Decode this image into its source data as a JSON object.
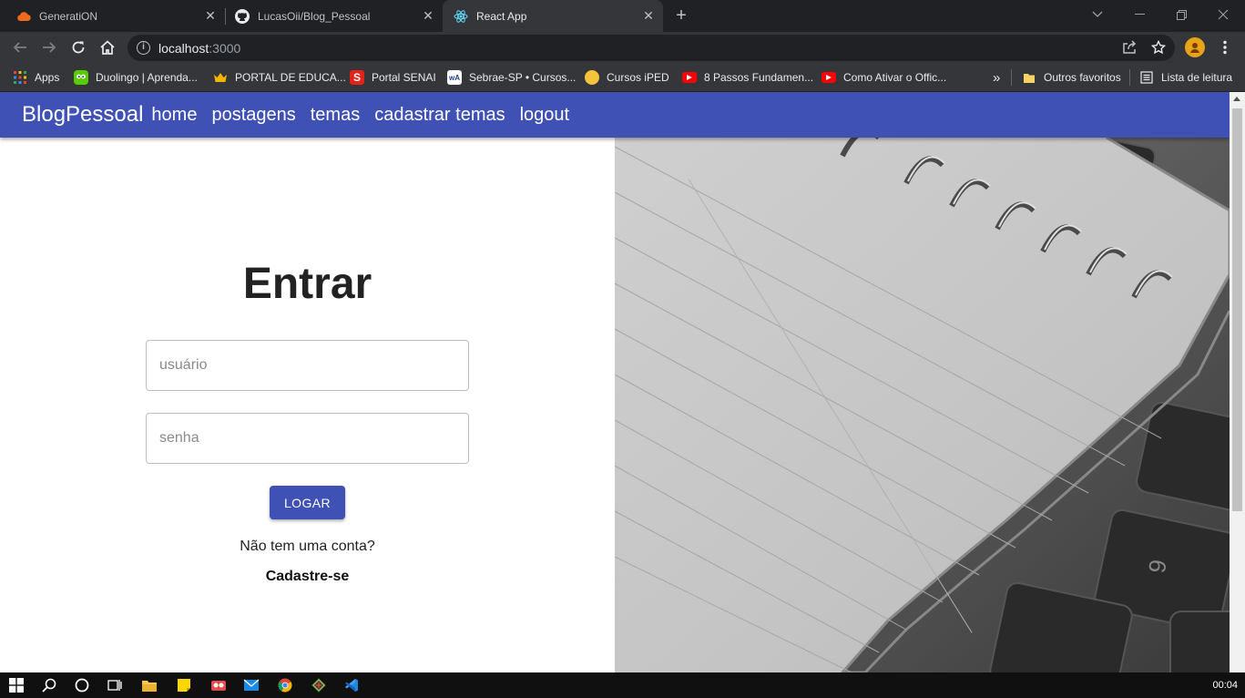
{
  "browser": {
    "tabs": [
      {
        "title": "GeneratiON",
        "icon": "cloud-icon",
        "active": false
      },
      {
        "title": "LucasOii/Blog_Pessoal",
        "icon": "github-icon",
        "active": false
      },
      {
        "title": "React App",
        "icon": "react-icon",
        "active": true
      }
    ],
    "url_host": "localhost",
    "url_port": ":3000",
    "bookmarks": [
      {
        "label": "Apps",
        "icon": "apps-grid-icon"
      },
      {
        "label": "Duolingo | Aprenda...",
        "icon": "duolingo-icon",
        "color": "#58cc02"
      },
      {
        "label": "PORTAL DE EDUCA...",
        "icon": "crown-icon",
        "color": "#f4b400"
      },
      {
        "label": "Portal SENAI",
        "icon": "senai-icon",
        "color": "#e2231a"
      },
      {
        "label": "Sebrae-SP • Cursos...",
        "icon": "sebrae-icon",
        "color": "#ffffff"
      },
      {
        "label": "Cursos iPED",
        "icon": "iped-icon",
        "color": "#f6c33d"
      },
      {
        "label": "8 Passos Fundamen...",
        "icon": "youtube-icon",
        "color": "#ff0000"
      },
      {
        "label": "Como Ativar o Offic...",
        "icon": "youtube-icon",
        "color": "#ff0000"
      }
    ],
    "overflow_label": "»",
    "other_bookmarks": "Outros favoritos",
    "reading_list": "Lista de leitura"
  },
  "app": {
    "brand": "BlogPessoal",
    "nav": [
      "home",
      "postagens",
      "temas",
      "cadastrar temas",
      "logout"
    ],
    "accent": "#3f51b5"
  },
  "login": {
    "title": "Entrar",
    "user_placeholder": "usuário",
    "password_placeholder": "senha",
    "button": "LOGAR",
    "no_account": "Não tem uma conta?",
    "signup": "Cadastre-se"
  },
  "taskbar": {
    "clock": "00:04"
  }
}
